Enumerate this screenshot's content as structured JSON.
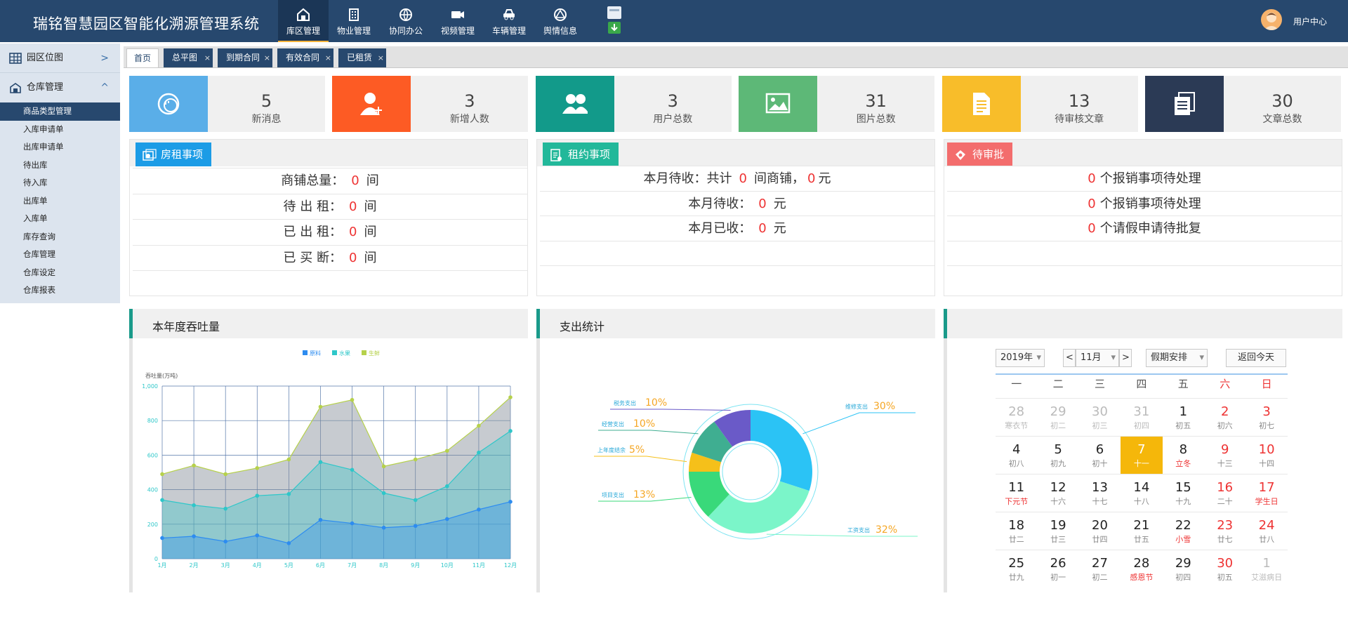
{
  "app": {
    "title": "瑞铭智慧园区智能化溯源管理系统",
    "user_center": "用户中心"
  },
  "nav": [
    {
      "label": "库区管理",
      "icon": "warehouse-icon",
      "active": true
    },
    {
      "label": "物业管理",
      "icon": "building-icon"
    },
    {
      "label": "协同办公",
      "icon": "globe-icon"
    },
    {
      "label": "视频管理",
      "icon": "video-camera-icon"
    },
    {
      "label": "车辆管理",
      "icon": "car-icon"
    },
    {
      "label": "舆情信息",
      "icon": "triangle-circle-icon"
    }
  ],
  "sidebar": {
    "groups": [
      {
        "label": "园区位图",
        "icon": "grid-map-icon",
        "chevron": ">"
      },
      {
        "label": "仓库管理",
        "icon": "warehouse-icon",
        "chevron": "^"
      }
    ],
    "items": [
      "商品类型管理",
      "入库申请单",
      "出库申请单",
      "待出库",
      "待入库",
      "出库单",
      "入库单",
      "库存查询",
      "仓库管理",
      "仓库设定",
      "仓库报表"
    ]
  },
  "tabs": [
    {
      "label": "首页",
      "closable": false
    },
    {
      "label": "总平图",
      "closable": true
    },
    {
      "label": "到期合同",
      "closable": true
    },
    {
      "label": "有效合同",
      "closable": true
    },
    {
      "label": "已租赁",
      "closable": true
    }
  ],
  "tab_close": "×",
  "stats": [
    {
      "value": "5",
      "label": "新消息",
      "color": "#5aaee8",
      "icon": "message-icon"
    },
    {
      "value": "3",
      "label": "新增人数",
      "color": "#fd5b24",
      "icon": "add-user-icon"
    },
    {
      "value": "3",
      "label": "用户总数",
      "color": "#129a8a",
      "icon": "users-icon"
    },
    {
      "value": "31",
      "label": "图片总数",
      "color": "#5db877",
      "icon": "image-icon"
    },
    {
      "value": "13",
      "label": "待审核文章",
      "color": "#f8bd2a",
      "icon": "document-icon"
    },
    {
      "value": "30",
      "label": "文章总数",
      "color": "#2b3a55",
      "icon": "files-icon"
    }
  ],
  "rent_panel": {
    "title": "房租事项",
    "rows": [
      {
        "label": "商铺总量：",
        "value": "0",
        "unit": "间"
      },
      {
        "label": "待 出 租：",
        "value": "0",
        "unit": "间"
      },
      {
        "label": "已 出 租：",
        "value": "0",
        "unit": "间"
      },
      {
        "label": "已 买 断：",
        "value": "0",
        "unit": "间"
      }
    ]
  },
  "lease_panel": {
    "title": "租约事项",
    "rows": [
      {
        "prefix": "本月待收：共计",
        "v1": "0",
        "mid": "间商铺，",
        "v2": "0",
        "suffix": "元"
      },
      {
        "prefix": "本月待收：",
        "v1": "0",
        "mid": "元",
        "v2": "",
        "suffix": ""
      },
      {
        "prefix": "本月已收：",
        "v1": "0",
        "mid": "元",
        "v2": "",
        "suffix": ""
      }
    ]
  },
  "approve_panel": {
    "title": "待审批",
    "rows": [
      {
        "value": "0",
        "text": "个报销事项待处理"
      },
      {
        "value": "0",
        "text": "个报销事项待处理"
      },
      {
        "value": "0",
        "text": "个请假申请待批复"
      }
    ]
  },
  "sections": {
    "throughput": "本年度吞吐量",
    "expense": "支出统计"
  },
  "chart_data": [
    {
      "type": "area",
      "title": "本年度吞吐量",
      "ylabel": "吞吐量(万吨)",
      "ylim": [
        0,
        1000
      ],
      "yticks": [
        "0",
        "200",
        "400",
        "600",
        "800",
        "1,000"
      ],
      "categories": [
        "1月",
        "2月",
        "3月",
        "4月",
        "5月",
        "6月",
        "7月",
        "8月",
        "9月",
        "10月",
        "11月",
        "12月"
      ],
      "legend_position": "top",
      "grid": true,
      "series": [
        {
          "name": "原料",
          "color": "#2d8cf0",
          "values": [
            120,
            130,
            100,
            135,
            90,
            225,
            205,
            180,
            190,
            230,
            285,
            330
          ]
        },
        {
          "name": "水果",
          "color": "#2ec7c9",
          "values": [
            340,
            310,
            290,
            365,
            375,
            560,
            515,
            380,
            340,
            420,
            615,
            740
          ]
        },
        {
          "name": "生鲜",
          "color": "#b6d14b",
          "values": [
            490,
            540,
            490,
            525,
            575,
            880,
            920,
            535,
            575,
            625,
            770,
            935
          ]
        }
      ]
    },
    {
      "type": "pie",
      "title": "支出统计",
      "series": [
        {
          "name": "维修支出",
          "value": 30,
          "label": "30%",
          "color": "#2bc3f5"
        },
        {
          "name": "工资支出",
          "value": 32,
          "label": "32%",
          "color": "#7bf5c9"
        },
        {
          "name": "项目支出",
          "value": 13,
          "label": "13%",
          "color": "#39d97a"
        },
        {
          "name": "上年度结余",
          "value": 5,
          "label": "5%",
          "color": "#f5c01a"
        },
        {
          "name": "经营支出",
          "value": 10,
          "label": "10%",
          "color": "#3fae91"
        },
        {
          "name": "税务支出",
          "value": 10,
          "label": "10%",
          "color": "#6a5ac8"
        }
      ]
    }
  ],
  "calendar": {
    "year": "2019年",
    "month": "11月",
    "holiday": "假期安排",
    "today_btn": "返回今天",
    "prev": "<",
    "next": ">",
    "dropdown": "▾",
    "weekdays": [
      "一",
      "二",
      "三",
      "四",
      "五",
      "六",
      "日"
    ],
    "days": [
      {
        "d": "28",
        "l": "寒衣节",
        "t": "other"
      },
      {
        "d": "29",
        "l": "初二",
        "t": "other"
      },
      {
        "d": "30",
        "l": "初三",
        "t": "other"
      },
      {
        "d": "31",
        "l": "初四",
        "t": "other"
      },
      {
        "d": "1",
        "l": "初五",
        "t": ""
      },
      {
        "d": "2",
        "l": "初六",
        "t": "weekend"
      },
      {
        "d": "3",
        "l": "初七",
        "t": "weekend"
      },
      {
        "d": "4",
        "l": "初八",
        "t": ""
      },
      {
        "d": "5",
        "l": "初九",
        "t": ""
      },
      {
        "d": "6",
        "l": "初十",
        "t": ""
      },
      {
        "d": "7",
        "l": "十一",
        "t": "today"
      },
      {
        "d": "8",
        "l": "立冬",
        "t": "festival"
      },
      {
        "d": "9",
        "l": "十三",
        "t": "weekend"
      },
      {
        "d": "10",
        "l": "十四",
        "t": "weekend"
      },
      {
        "d": "11",
        "l": "下元节",
        "t": "festival"
      },
      {
        "d": "12",
        "l": "十六",
        "t": ""
      },
      {
        "d": "13",
        "l": "十七",
        "t": ""
      },
      {
        "d": "14",
        "l": "十八",
        "t": ""
      },
      {
        "d": "15",
        "l": "十九",
        "t": ""
      },
      {
        "d": "16",
        "l": "二十",
        "t": "weekend"
      },
      {
        "d": "17",
        "l": "学生日",
        "t": "weekend festival"
      },
      {
        "d": "18",
        "l": "廿二",
        "t": ""
      },
      {
        "d": "19",
        "l": "廿三",
        "t": ""
      },
      {
        "d": "20",
        "l": "廿四",
        "t": ""
      },
      {
        "d": "21",
        "l": "廿五",
        "t": ""
      },
      {
        "d": "22",
        "l": "小雪",
        "t": "festival"
      },
      {
        "d": "23",
        "l": "廿七",
        "t": "weekend"
      },
      {
        "d": "24",
        "l": "廿八",
        "t": "weekend"
      },
      {
        "d": "25",
        "l": "廿九",
        "t": ""
      },
      {
        "d": "26",
        "l": "初一",
        "t": ""
      },
      {
        "d": "27",
        "l": "初二",
        "t": ""
      },
      {
        "d": "28",
        "l": "感恩节",
        "t": "festival"
      },
      {
        "d": "29",
        "l": "初四",
        "t": ""
      },
      {
        "d": "30",
        "l": "初五",
        "t": "weekend"
      },
      {
        "d": "1",
        "l": "艾滋病日",
        "t": "other"
      }
    ]
  }
}
